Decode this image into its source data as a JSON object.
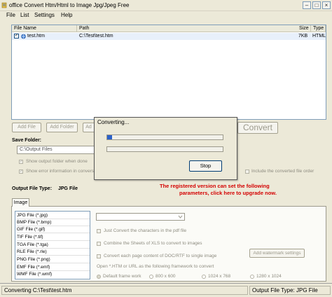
{
  "window": {
    "title": "office Convert Htm/Html to Image Jpg/Jpeg Free"
  },
  "menu": [
    "File",
    "List",
    "Settings",
    "Help"
  ],
  "file_table": {
    "columns": [
      "File Name",
      "Path",
      "Size",
      "Type"
    ],
    "rows": [
      {
        "name": "test.htm",
        "path": "C:\\Test\\test.htm",
        "size": "7KB",
        "type": "HTML",
        "checked": true
      }
    ]
  },
  "toolbar": {
    "add_file": "Add File",
    "add_folder": "Add Folder",
    "add_partial": "Ad",
    "convert": "Convert"
  },
  "save_folder": {
    "label": "Save Folder:",
    "value": "C:\\Output Files",
    "show_output_folder": "Show output folder when done",
    "show_error_info": "Show error information in conversi",
    "include_converted_order": "Include the converted file order"
  },
  "output_type": {
    "label": "Output File Type:",
    "value": "JPG File"
  },
  "notice": {
    "line1": "The registered version can set the following",
    "line2": "parameters, click here to upgrade now."
  },
  "dialog": {
    "title": "Converting...",
    "progress": 0.04,
    "stop": "Stop"
  },
  "tab": {
    "label": "Image"
  },
  "formats": [
    "JPG File  (*.jpg)",
    "BMP File  (*.bmp)",
    "GIF File  (*.gif)",
    "TIF File  (*.tif)",
    "TGA File  (*.tga)",
    "RLE File  (*.rle)",
    "PNG File  (*.png)",
    "EMF File  (*.emf)",
    "WMF File  (*.wmf)"
  ],
  "options": {
    "just_convert": "Just Convert the characters in the pdf file",
    "combine_sheets": "Combine the Sheets of XLS to convert to images",
    "convert_each_page": "Convert each page content of DOC/RTF to single image",
    "add_watermark": "Add watermark settings",
    "open_framework": "Open *.HTM or URL as the following framework to convert",
    "radios": [
      "Default frame work",
      "800 x 600",
      "1024 x 768",
      "1280 x 1024"
    ]
  },
  "status": {
    "left": "Converting  C:\\Test\\test.htm",
    "right": "Output File Type:  JPG File"
  }
}
